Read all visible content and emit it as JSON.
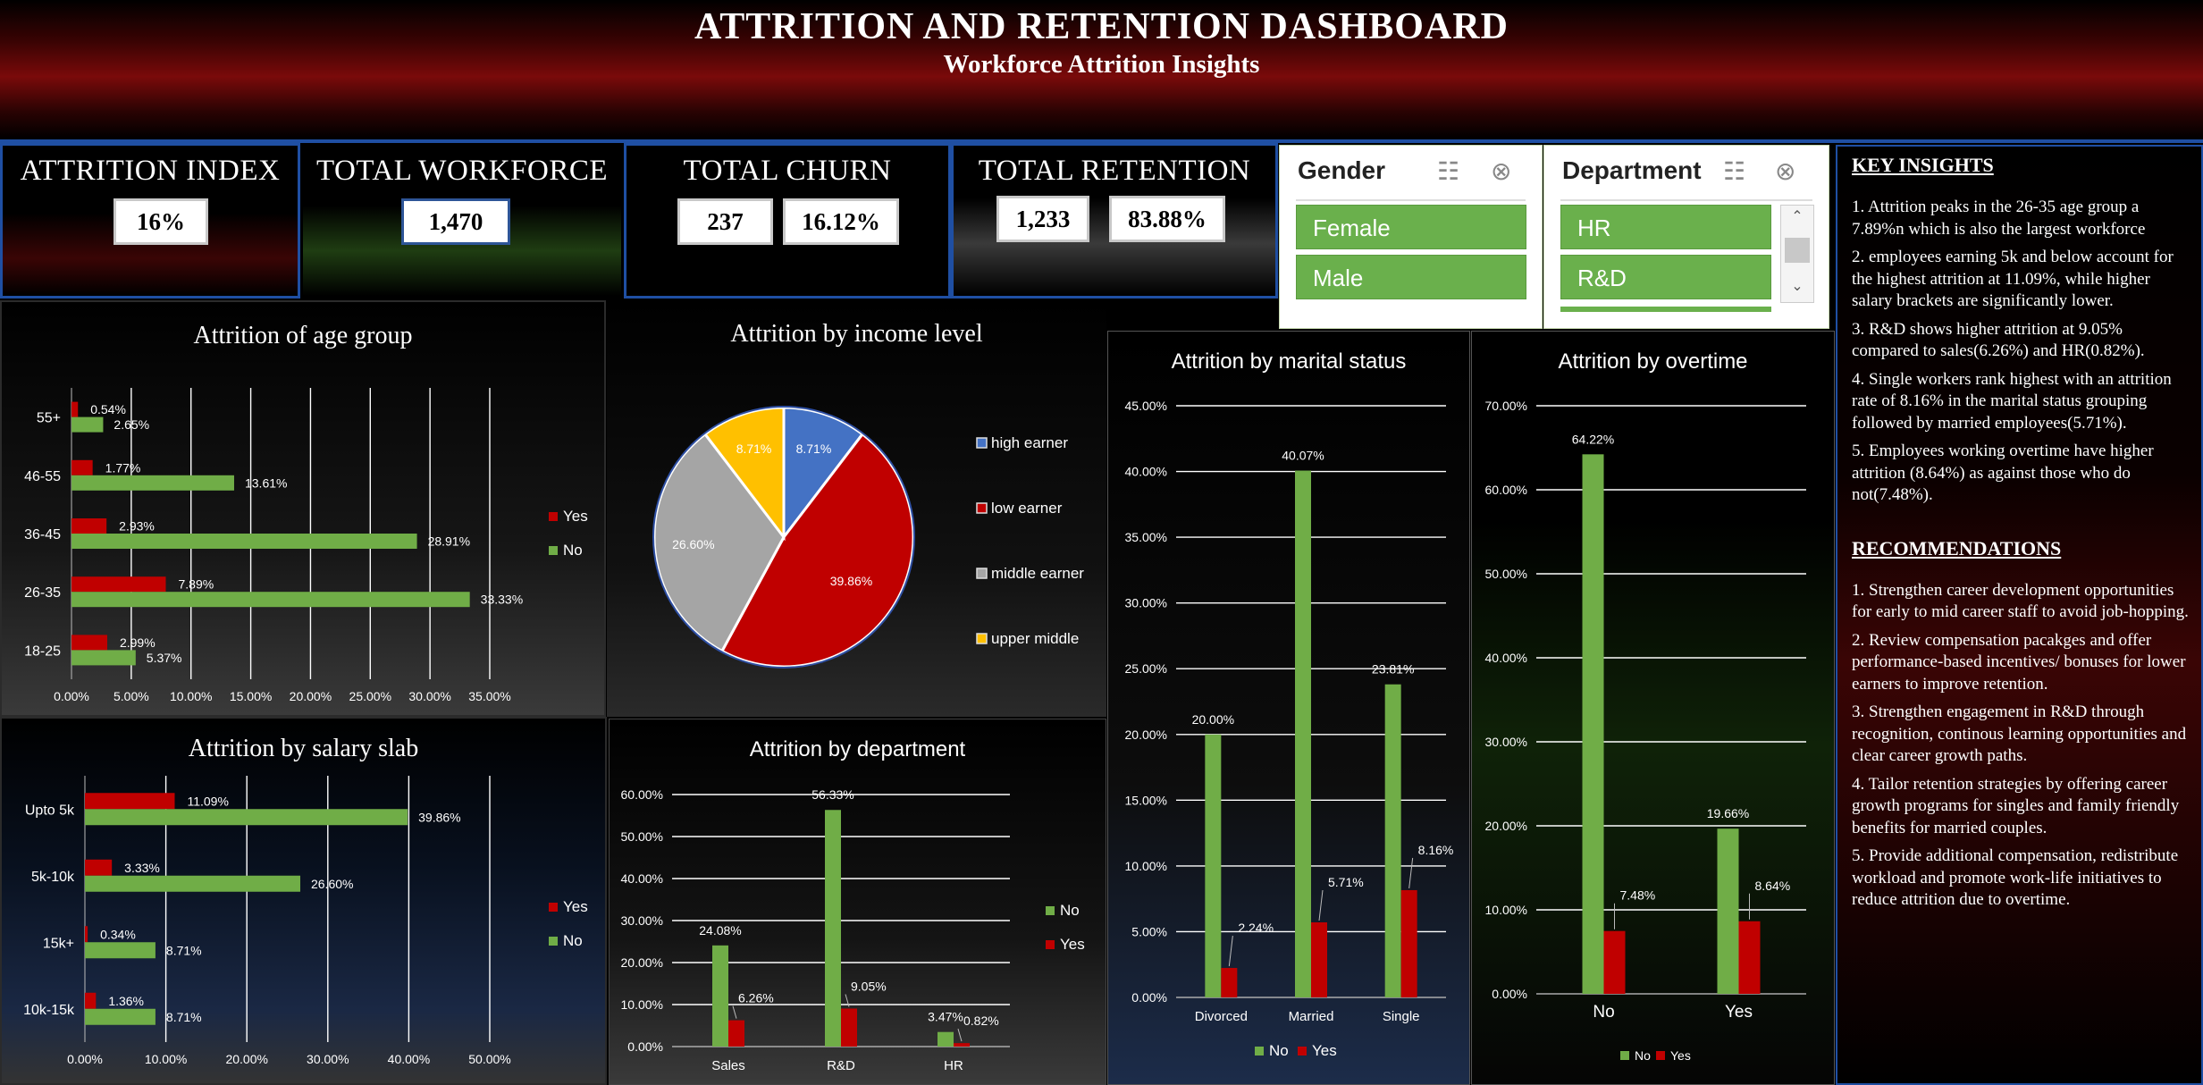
{
  "header": {
    "title": "ATTRITION AND RETENTION DASHBOARD",
    "subtitle": "Workforce Attrition Insights"
  },
  "kpis": {
    "attrition_index": {
      "label": "ATTRITION INDEX",
      "value": "16%"
    },
    "total_workforce": {
      "label": "TOTAL WORKFORCE",
      "value": "1,470"
    },
    "total_churn": {
      "label": "TOTAL CHURN",
      "count": "237",
      "pct": "16.12%"
    },
    "total_retention": {
      "label": "TOTAL RETENTION",
      "count": "1,233",
      "pct": "83.88%"
    }
  },
  "slicers": {
    "gender": {
      "title": "Gender",
      "items": [
        "Female",
        "Male"
      ]
    },
    "department": {
      "title": "Department",
      "items": [
        "HR",
        "R&D"
      ]
    }
  },
  "colors": {
    "yes": "#c00000",
    "no": "#70ad47",
    "high": "#4472c4",
    "low": "#c00000",
    "middle": "#a5a5a5",
    "upper": "#ffc000"
  },
  "insights": {
    "key_title": "KEY INSIGHTS",
    "key_items": [
      "1. Attrition peaks in the 26-35 age group a 7.89%n which is also the largest workforce",
      "2. employees earning 5k and below account for the highest attrition at 11.09%, while higher salary brackets are significantly lower.",
      "3. R&D shows higher attrition at 9.05% compared to sales(6.26%) and HR(0.82%).",
      "4. Single workers rank highest with an attrition rate of 8.16% in the marital status grouping followed by married employees(5.71%).",
      "5. Employees working overtime have higher attrition (8.64%) as against those who do not(7.48%)."
    ],
    "rec_title": "RECOMMENDATIONS",
    "rec_items": [
      "1. Strengthen career development opportunities for early to mid career staff to avoid job-hopping.",
      "2. Review compensation pacakges and offer performance-based incentives/ bonuses for lower earners to improve retention.",
      "3. Strengthen engagement in R&D through recognition, continous learning opportunities and clear career growth paths.",
      "4. Tailor retention strategies by offering career growth programs for singles and family friendly benefits for married couples.",
      "5. Provide additional compensation, redistribute workload and promote work-life initiatives to reduce attrition due to overtime."
    ]
  },
  "chart_data": [
    {
      "id": "age",
      "type": "bar",
      "orientation": "horizontal",
      "title": "Attrition of age group",
      "categories": [
        "55+",
        "46-55",
        "36-45",
        "26-35",
        "18-25"
      ],
      "series": [
        {
          "name": "Yes",
          "values": [
            0.54,
            1.77,
            2.93,
            7.89,
            2.99
          ],
          "labels": [
            "0.54%",
            "1.77%",
            "2.93%",
            "7.89%",
            "2.99%"
          ]
        },
        {
          "name": "No",
          "values": [
            2.65,
            13.61,
            28.91,
            33.33,
            5.37
          ],
          "labels": [
            "2.65%",
            "13.61%",
            "28.91%",
            "33.33%",
            "5.37%"
          ]
        }
      ],
      "xlim": [
        0,
        35
      ],
      "ticks": [
        "0.00%",
        "5.00%",
        "10.00%",
        "15.00%",
        "20.00%",
        "25.00%",
        "30.00%",
        "35.00%"
      ],
      "legend": "right"
    },
    {
      "id": "income",
      "type": "pie",
      "title": "Attrition by income level",
      "slices": [
        {
          "name": "high earner",
          "value": 8.71,
          "label": "8.71%"
        },
        {
          "name": "low earner",
          "value": 39.86,
          "label": "39.86%"
        },
        {
          "name": "middle earner",
          "value": 26.6,
          "label": "26.60%"
        },
        {
          "name": "upper middle",
          "value": 8.71,
          "label": "8.71%"
        }
      ],
      "legend": "right"
    },
    {
      "id": "salary",
      "type": "bar",
      "orientation": "horizontal",
      "title": "Attrition by salary slab",
      "categories": [
        "Upto 5k",
        "5k-10k",
        "15k+",
        "10k-15k"
      ],
      "series": [
        {
          "name": "Yes",
          "values": [
            11.09,
            3.33,
            0.34,
            1.36
          ],
          "labels": [
            "11.09%",
            "3.33%",
            "0.34%",
            "1.36%"
          ]
        },
        {
          "name": "No",
          "values": [
            39.86,
            26.6,
            8.71,
            8.71
          ],
          "labels": [
            "39.86%",
            "26.60%",
            "8.71%",
            "8.71%"
          ]
        }
      ],
      "xlim": [
        0,
        50
      ],
      "ticks": [
        "0.00%",
        "10.00%",
        "20.00%",
        "30.00%",
        "40.00%",
        "50.00%"
      ],
      "legend": "right"
    },
    {
      "id": "dept",
      "type": "bar",
      "title": "Attrition by department",
      "categories": [
        "Sales",
        "R&D",
        "HR"
      ],
      "series": [
        {
          "name": "No",
          "values": [
            24.08,
            56.33,
            3.47
          ],
          "labels": [
            "24.08%",
            "56.33%",
            "3.47%"
          ]
        },
        {
          "name": "Yes",
          "values": [
            6.26,
            9.05,
            0.82
          ],
          "labels": [
            "6.26%",
            "9.05%",
            "0.82%"
          ]
        }
      ],
      "ylim": [
        0,
        60
      ],
      "ticks": [
        "0.00%",
        "10.00%",
        "20.00%",
        "30.00%",
        "40.00%",
        "50.00%",
        "60.00%"
      ],
      "legend": "right"
    },
    {
      "id": "marital",
      "type": "bar",
      "title": "Attrition by marital status",
      "categories": [
        "Divorced",
        "Married",
        "Single"
      ],
      "series": [
        {
          "name": "No",
          "values": [
            20.0,
            40.07,
            23.81
          ],
          "labels": [
            "20.00%",
            "40.07%",
            "23.81%"
          ]
        },
        {
          "name": "Yes",
          "values": [
            2.24,
            5.71,
            8.16
          ],
          "labels": [
            "2.24%",
            "5.71%",
            "8.16%"
          ]
        }
      ],
      "ylim": [
        0,
        45
      ],
      "ticks": [
        "0.00%",
        "5.00%",
        "10.00%",
        "15.00%",
        "20.00%",
        "25.00%",
        "30.00%",
        "35.00%",
        "40.00%",
        "45.00%"
      ],
      "legend": "bottom"
    },
    {
      "id": "overtime",
      "type": "bar",
      "title": "Attrition by overtime",
      "categories": [
        "No",
        "Yes"
      ],
      "series": [
        {
          "name": "No",
          "values": [
            64.22,
            19.66
          ],
          "labels": [
            "64.22%",
            "19.66%"
          ]
        },
        {
          "name": "Yes",
          "values": [
            7.48,
            8.64
          ],
          "labels": [
            "7.48%",
            "8.64%"
          ]
        }
      ],
      "ylim": [
        0,
        70
      ],
      "ticks": [
        "0.00%",
        "10.00%",
        "20.00%",
        "30.00%",
        "40.00%",
        "50.00%",
        "60.00%",
        "70.00%"
      ],
      "legend": "bottom"
    }
  ]
}
